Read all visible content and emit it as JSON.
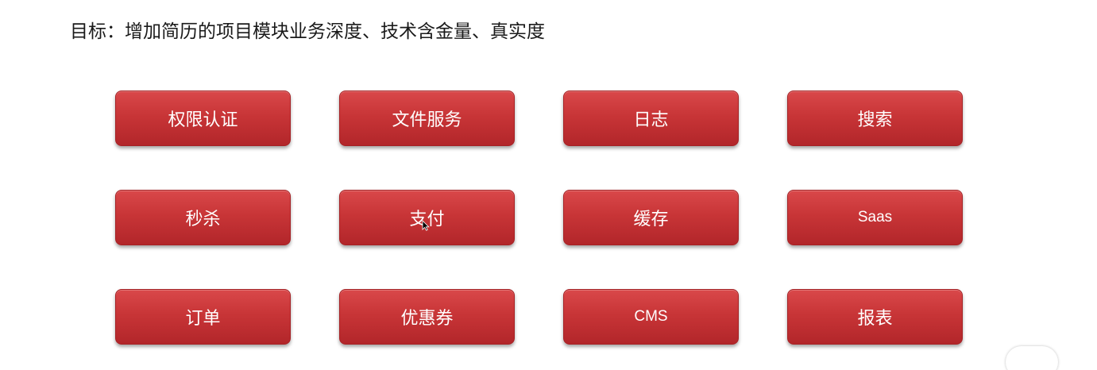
{
  "slide": {
    "title": "目标：增加简历的项目模块业务深度、技术含金量、真实度"
  },
  "modules": [
    {
      "label": "权限认证"
    },
    {
      "label": "文件服务"
    },
    {
      "label": "日志"
    },
    {
      "label": "搜索"
    },
    {
      "label": "秒杀"
    },
    {
      "label": "支付"
    },
    {
      "label": "缓存"
    },
    {
      "label": "Saas"
    },
    {
      "label": "订单"
    },
    {
      "label": "优惠券"
    },
    {
      "label": "CMS"
    },
    {
      "label": "报表"
    }
  ],
  "colors": {
    "button_top": "#d9484a",
    "button_bottom": "#b2262a",
    "button_text": "#ffffff",
    "title_text": "#1a1a1a"
  },
  "icons": {
    "cursor": "mouse-pointer-icon"
  }
}
